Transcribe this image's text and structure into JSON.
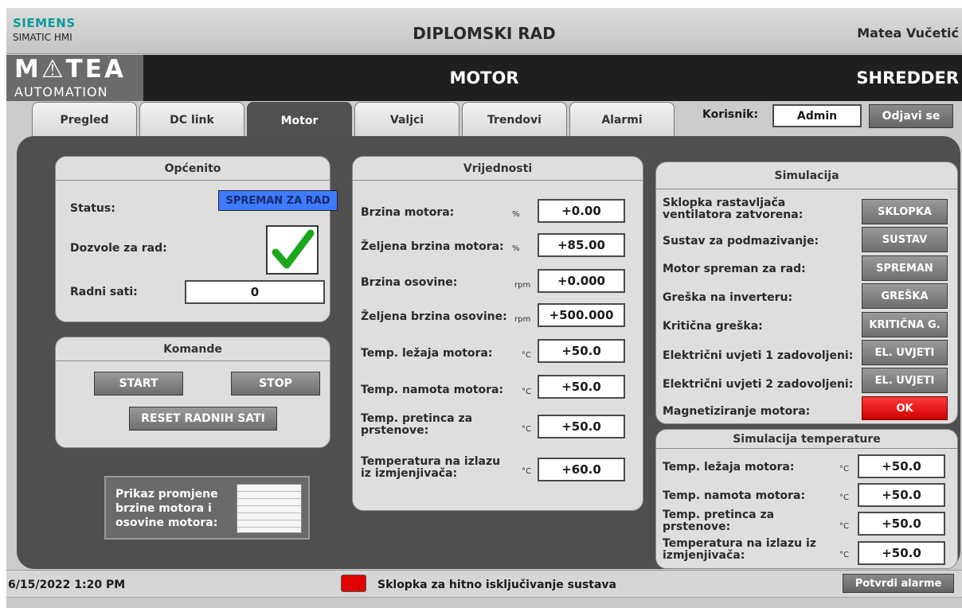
{
  "topbar": {
    "brand": "SIEMENS",
    "brand_sub": "SIMATIC HMI",
    "title": "DIPLOMSKI RAD",
    "user_display": "Matea Vučetić"
  },
  "header": {
    "logo_main": "M⚠TEA",
    "logo_sub": "AUTOMATION",
    "screen_title": "MOTOR",
    "machine": "SHREDDER"
  },
  "tabs": [
    {
      "label": "Pregled"
    },
    {
      "label": "DC link"
    },
    {
      "label": "Motor",
      "active": true
    },
    {
      "label": "Valjci"
    },
    {
      "label": "Trendovi"
    },
    {
      "label": "Alarmi"
    }
  ],
  "user": {
    "label": "Korisnik:",
    "value": "Admin",
    "logout_label": "Odjavi se"
  },
  "general": {
    "title": "Općenito",
    "status_label": "Status:",
    "status_value": "SPREMAN ZA RAD",
    "permissions_label": "Dozvole za rad:",
    "permissions_icon": "checkmark-icon",
    "hours_label": "Radni sati:",
    "hours_value": "0"
  },
  "commands": {
    "title": "Komande",
    "start_label": "START",
    "stop_label": "STOP",
    "reset_label": "RESET RADNIH SATI"
  },
  "trend_button": {
    "label": "Prikaz promjene brzine motora i osovine motora:",
    "icon": "trend-table-icon"
  },
  "values": {
    "title": "Vrijednosti",
    "rows": [
      {
        "label": "Brzina motora:",
        "unit": "%",
        "value": "+0.00"
      },
      {
        "label": "Željena brzina motora:",
        "unit": "%",
        "value": "+85.00"
      },
      {
        "label": "Brzina osovine:",
        "unit": "rpm",
        "value": "+0.000"
      },
      {
        "label": "Željena brzina osovine:",
        "unit": "rpm",
        "value": "+500.000"
      },
      {
        "label": "Temp. ležaja motora:",
        "unit": "°C",
        "value": "+50.0"
      },
      {
        "label": "Temp. namota motora:",
        "unit": "°C",
        "value": "+50.0"
      },
      {
        "label": "Temp. pretinca za prstenove:",
        "unit": "°C",
        "value": "+50.0"
      },
      {
        "label": "Temperatura na izlazu iz izmjenjivača:",
        "unit": "°C",
        "value": "+60.0"
      }
    ]
  },
  "simulation": {
    "title": "Simulacija",
    "rows": [
      {
        "label": "Sklopka rastavljača ventilatora zatvorena:",
        "button": "SKLOPKA"
      },
      {
        "label": "Sustav za podmazivanje:",
        "button": "SUSTAV"
      },
      {
        "label": "Motor spreman za rad:",
        "button": "SPREMAN"
      },
      {
        "label": "Greška na inverteru:",
        "button": "GREŠKA"
      },
      {
        "label": "Kritična greška:",
        "button": "KRITIČNA G."
      },
      {
        "label": "Električni uvjeti 1 zadovoljeni:",
        "button": "EL. UVJETI"
      },
      {
        "label": "Električni uvjeti 2 zadovoljeni:",
        "button": "EL. UVJETI"
      },
      {
        "label": "Magnetiziranje motora:",
        "button": "OK",
        "state": "red"
      }
    ]
  },
  "temp_simulation": {
    "title": "Simulacija temperature",
    "rows": [
      {
        "label": "Temp. ležaja motora:",
        "unit": "°C",
        "value": "+50.0"
      },
      {
        "label": "Temp. namota motora:",
        "unit": "°C",
        "value": "+50.0"
      },
      {
        "label": "Temp. pretinca za prstenove:",
        "unit": "°C",
        "value": "+50.0"
      },
      {
        "label": "Temperatura na izlazu iz izmjenjivača:",
        "unit": "°C",
        "value": "+50.0"
      }
    ]
  },
  "footer": {
    "datetime": "6/15/2022 1:20 PM",
    "estop_label": "Sklopka za hitno isključivanje sustava",
    "ack_label": "Potvrdi alarme"
  },
  "colors": {
    "status_blue": "#3d7bff",
    "alarm_red": "#e00000",
    "check_green": "#1aa81a",
    "brand_teal": "#0a9c9a"
  }
}
